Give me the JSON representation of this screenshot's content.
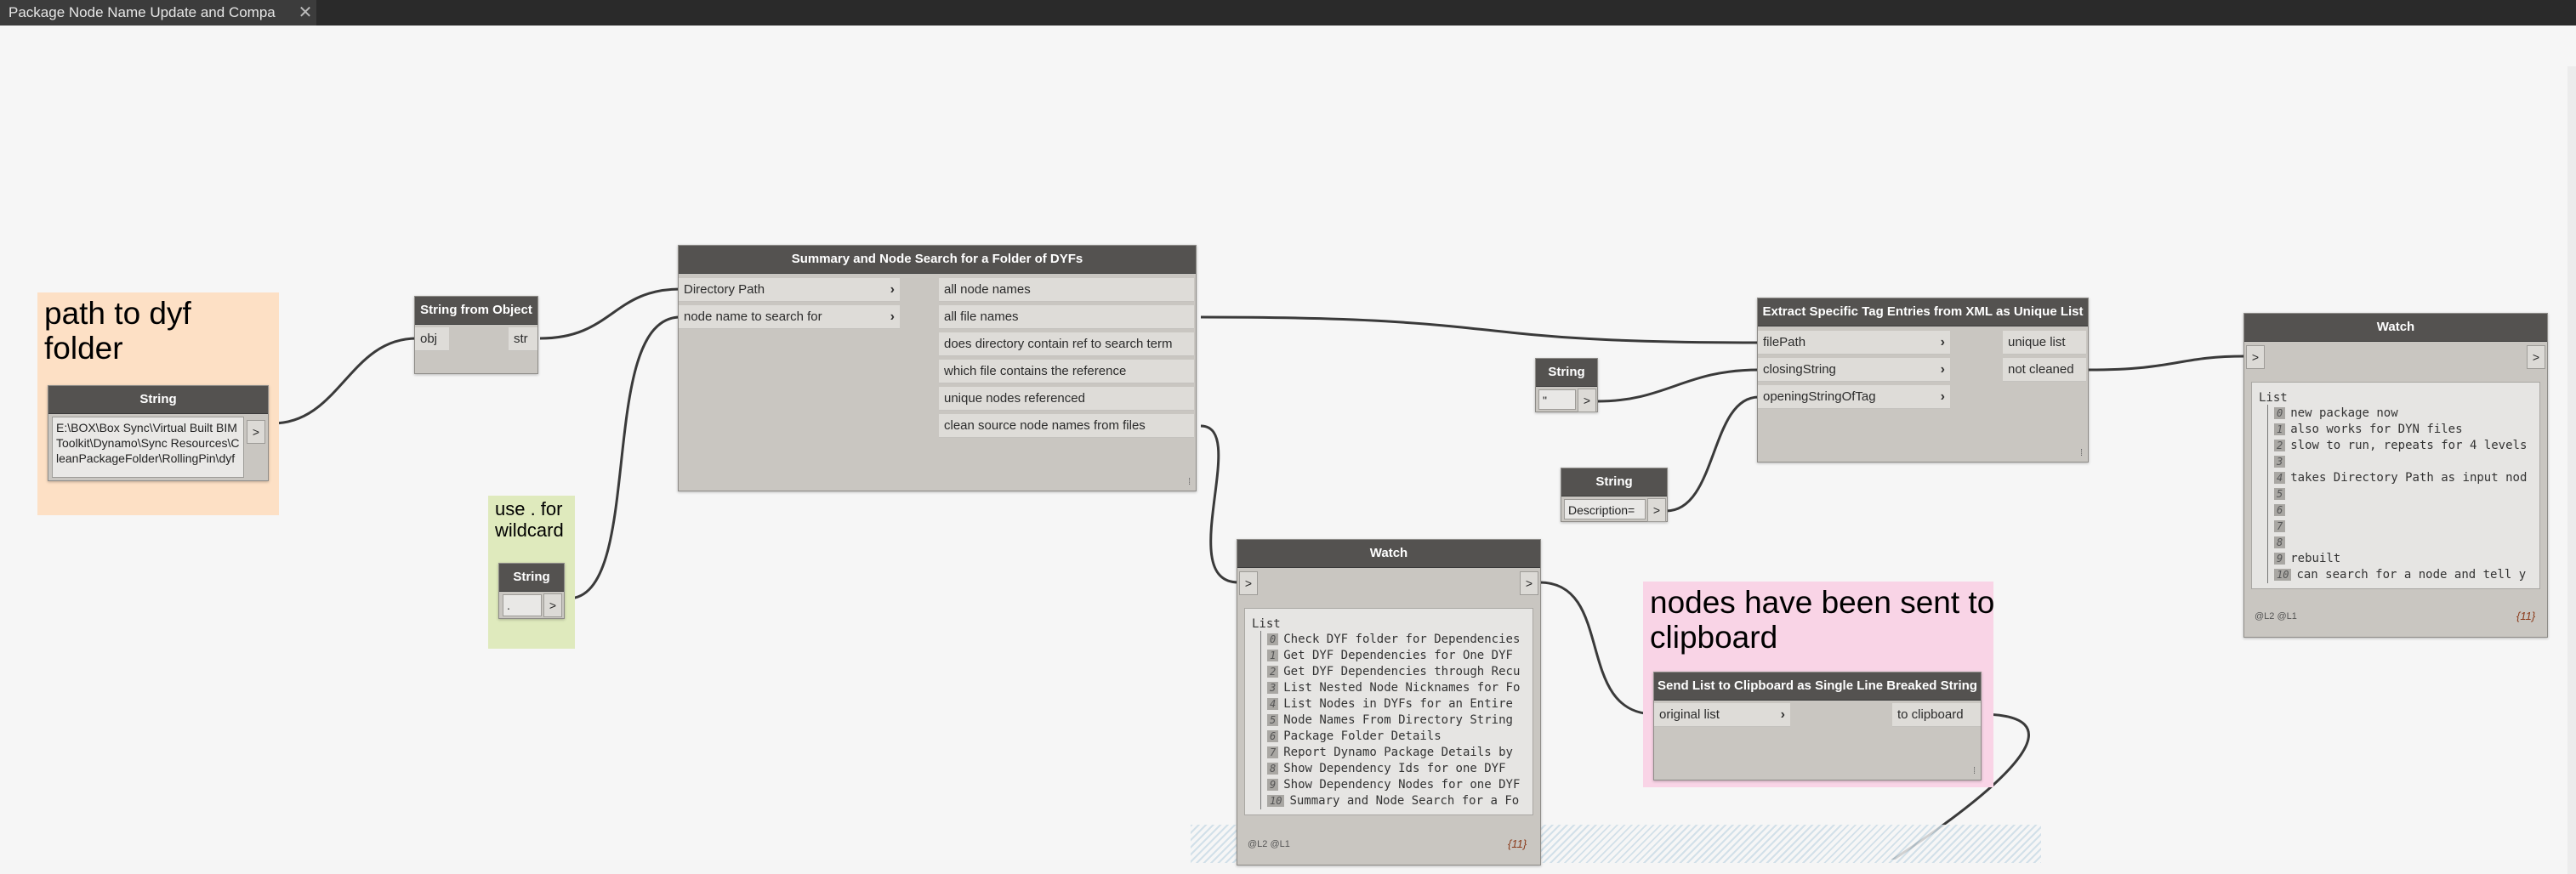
{
  "window": {
    "tab_title": "Package Node Name Update and Compa",
    "close_glyph": "✕"
  },
  "groups": {
    "path": {
      "title": "path to dyf folder",
      "color": "#fde0c5"
    },
    "wildcard": {
      "title": "use . for wildcard",
      "color": "#dfeabd"
    },
    "clipboard": {
      "title": "nodes have been sent to clipboard",
      "color": "#f9d4e6"
    }
  },
  "nodes": {
    "string_path": {
      "title": "String",
      "value": "E:\\BOX\\Box Sync\\Virtual Built BIM Toolkit\\Dynamo\\Sync Resources\\CleanPackageFolder\\RollingPin\\dyf",
      "out": ">"
    },
    "string_from_object": {
      "title": "String from Object",
      "in": "obj",
      "out": "str"
    },
    "string_dot": {
      "title": "String",
      "value": ".",
      "out": ">"
    },
    "summary": {
      "title": "Summary and Node Search for a Folder of DYFs",
      "inputs": [
        "Directory Path",
        "node name to search for"
      ],
      "outputs": [
        "all node names",
        "all file names",
        "does directory contain ref to search term",
        "which file contains the reference",
        "unique nodes referenced",
        "clean source node names from files"
      ]
    },
    "string_quote": {
      "title": "String",
      "value": "\"",
      "out": ">"
    },
    "string_desc": {
      "title": "String",
      "value": "Description=",
      "out": ">"
    },
    "extract": {
      "title": "Extract Specific Tag Entries from XML as Unique List",
      "inputs": [
        "filePath",
        "closingString",
        "openingStringOfTag"
      ],
      "outputs": [
        "unique list",
        "not cleaned"
      ]
    },
    "send_clipboard": {
      "title": "Send List to Clipboard as Single Line Breaked String",
      "inputs": [
        "original list"
      ],
      "outputs": [
        "to clipboard"
      ]
    },
    "watch_middle": {
      "title": "Watch",
      "in": ">",
      "out": ">",
      "list_label": "List",
      "items": [
        "Check DYF folder for Dependencies",
        "Get DYF Dependencies for One DYF",
        "Get DYF Dependencies through Recu",
        "List Nested Node Nicknames for Fo",
        "List Nodes in DYFs for an Entire",
        "Node Names From Directory String",
        "Package Folder Details",
        "Report Dynamo Package Details by",
        "Show Dependency Ids for one DYF",
        "Show Dependency Nodes for one DYF",
        "Summary and Node Search for a Fo"
      ],
      "footer": "@L2 @L1",
      "count": "{11}"
    },
    "watch_right": {
      "title": "Watch",
      "in": ">",
      "out": ">",
      "list_label": "List",
      "items": [
        "new package now",
        "also works for DYN files",
        "slow to run, repeats for 4 levels",
        "",
        "takes Directory Path as input nod",
        "",
        "",
        "",
        "",
        "rebuilt",
        "can search for a node and tell y"
      ],
      "footer": "@L2 @L1",
      "count": "{11}"
    }
  },
  "resize_glyph": "⁞"
}
